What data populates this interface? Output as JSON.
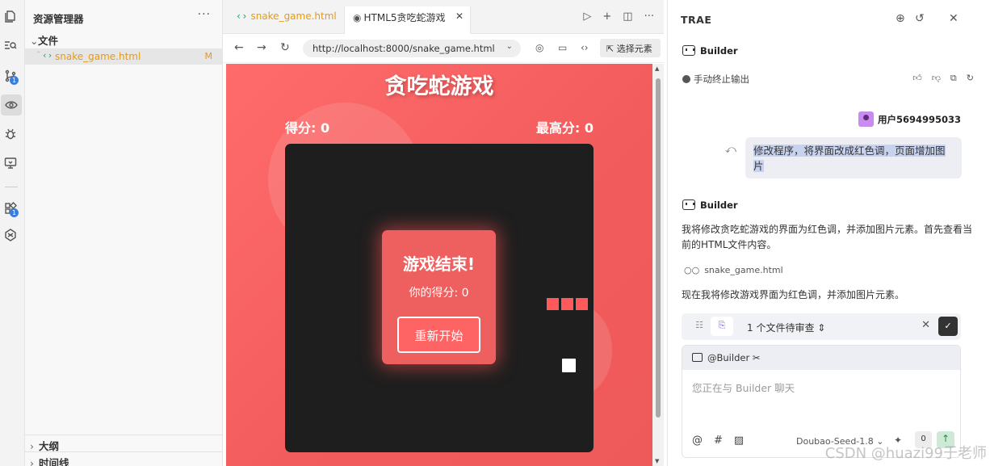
{
  "explorer": {
    "title": "资源管理器",
    "more": "···",
    "section": "文件",
    "file": {
      "name": "snake_game.html",
      "status": "M"
    },
    "outline": "大纲",
    "timeline": "时间线"
  },
  "activity_badges": {
    "scm": "1",
    "ext": "1"
  },
  "tabs": [
    {
      "icon": "‹›",
      "label": "snake_game.html"
    },
    {
      "icon": "◉",
      "label": "HTML5贪吃蛇游戏",
      "close": "✕"
    }
  ],
  "browser": {
    "url": "http://localhost:8000/snake_game.html",
    "select_element": "选择元素"
  },
  "game": {
    "title": "贪吃蛇游戏",
    "score_label": "得分: 0",
    "high_score_label": "最高分: 0",
    "game_over_title": "游戏结束!",
    "final_score": "你的得分: 0",
    "restart": "重新开始"
  },
  "panel": {
    "title": "TRAE",
    "bot_name": "Builder",
    "stopped": "手动终止输出",
    "user_name": "用户5694995033",
    "user_message": "修改程序，将界面改成红色调，页面增加图片",
    "reply1": "我将修改贪吃蛇游戏的界面为红色调，并添加图片元素。首先查看当前的HTML文件内容。",
    "file_ref": "snake_game.html",
    "reply2": "现在我将修改游戏界面为红色调，并添加图片元素。",
    "review": "1 个文件待审查",
    "mention": "@Builder",
    "placeholder": "您正在与 Builder 聊天",
    "model": "Doubao-Seed-1.8",
    "count": "0",
    "watermark": "CSDN @huazi99于老师"
  },
  "colors": {
    "accent_red": "#ff6b6b",
    "board": "#1e1e1e",
    "file_modified": "#e89a10"
  }
}
